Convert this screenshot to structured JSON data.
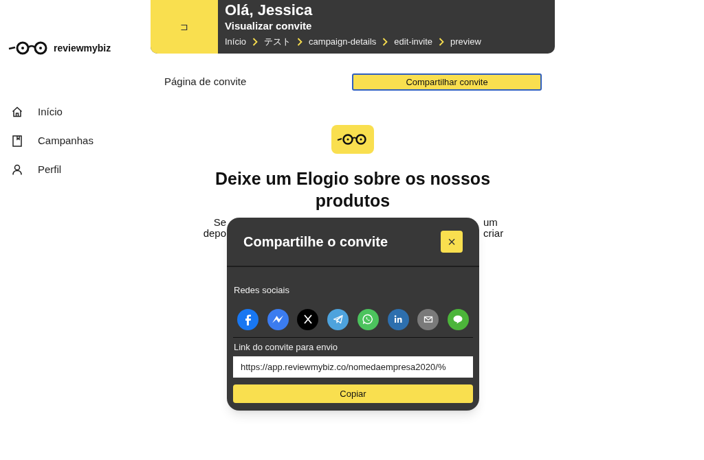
{
  "logo": {
    "text": "reviewmybiz"
  },
  "sidebar": {
    "items": [
      {
        "kind": "home",
        "label": "Início"
      },
      {
        "kind": "book",
        "label": "Campanhas"
      },
      {
        "kind": "user",
        "label": "Perfil"
      }
    ]
  },
  "header": {
    "back_icon": "⊐",
    "greeting": "Olá, Jessica",
    "subtitle": "Visualizar convite",
    "breadcrumbs": [
      "Início",
      "テスト",
      "campaign-details",
      "edit-invite",
      "preview"
    ]
  },
  "page": {
    "title": "Página de convite",
    "share_button": "Compartilhar convite",
    "heading": "Deixe um Elogio sobre os nossos produtos",
    "body_left": [
      "Se",
      "depo"
    ],
    "body_right": [
      "um",
      "criar"
    ]
  },
  "modal": {
    "title": "Compartilhe o convite",
    "close": "×",
    "social_label": "Redes sociais",
    "social": [
      {
        "kind": "facebook"
      },
      {
        "kind": "messenger"
      },
      {
        "kind": "x"
      },
      {
        "kind": "telegram"
      },
      {
        "kind": "whatsapp"
      },
      {
        "kind": "linkedin"
      },
      {
        "kind": "email"
      },
      {
        "kind": "line"
      }
    ],
    "link_label": "Link do convite para envio",
    "link_value": "https://app.reviewmybiz.co/nomedaempresa2020/%",
    "copy_button": "Copiar"
  }
}
